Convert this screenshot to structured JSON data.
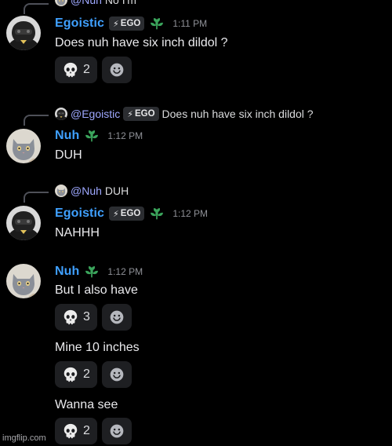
{
  "top_fragment": {
    "mention": "@Nuh",
    "text": "No I'm"
  },
  "users": {
    "egoistic": {
      "name": "Egoistic",
      "tag": "EGO"
    },
    "nuh": {
      "name": "Nuh"
    }
  },
  "messages": [
    {
      "author": "Egoistic",
      "time": "1:11 PM",
      "text": "Does nuh have six inch dildol ?",
      "reactions": [
        {
          "emoji": "skull",
          "count": "2"
        }
      ]
    },
    {
      "reply_to": {
        "mention": "@Egoistic",
        "tag": "EGO",
        "text": "Does nuh have six inch dildol ?"
      },
      "author": "Nuh",
      "time": "1:12 PM",
      "text": "DUH"
    },
    {
      "reply_to": {
        "mention": "@Nuh",
        "text": "DUH"
      },
      "author": "Egoistic",
      "time": "1:12 PM",
      "text": "NAHHH"
    },
    {
      "author": "Nuh",
      "time": "1:12 PM",
      "text": "But I also have",
      "reactions": [
        {
          "emoji": "skull",
          "count": "3"
        }
      ]
    },
    {
      "text": "Mine 10 inches",
      "reactions": [
        {
          "emoji": "skull",
          "count": "2"
        }
      ]
    },
    {
      "text": "Wanna see",
      "reactions": [
        {
          "emoji": "skull",
          "count": "2"
        }
      ]
    }
  ],
  "watermark": "imgflip.com",
  "colors": {
    "username": "#3fa0ff",
    "mention": "#9ea8ff",
    "badge": "#3ba55c",
    "background": "#000000",
    "reaction_bg": "#1e1f22"
  }
}
